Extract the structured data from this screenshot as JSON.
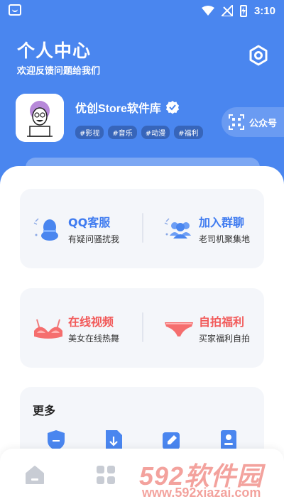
{
  "status_bar": {
    "time": "3:10"
  },
  "header": {
    "title": "个人中心",
    "subtitle": "欢迎反馈问题给我们",
    "settings_icon": "settings-hexagon-icon"
  },
  "profile": {
    "name": "优创Store软件库",
    "verified_icon": "verified-badge-icon",
    "tags": [
      "#影视",
      "#音乐",
      "#动漫",
      "#福利"
    ],
    "official_account_label": "公众号"
  },
  "contact_card": {
    "items": [
      {
        "title": "QQ客服",
        "subtitle": "有疑问骚扰我",
        "icon": "qq-penguin-icon"
      },
      {
        "title": "加入群聊",
        "subtitle": "老司机聚集地",
        "icon": "group-users-icon"
      }
    ]
  },
  "fun_card": {
    "items": [
      {
        "title": "在线视频",
        "subtitle": "美女在线热舞",
        "icon": "bra-icon"
      },
      {
        "title": "自拍福利",
        "subtitle": "买家福利自拍",
        "icon": "underwear-icon"
      }
    ]
  },
  "more_card": {
    "title": "更多",
    "icons": [
      "shield-icon",
      "download-file-icon",
      "edit-icon",
      "contact-book-icon"
    ]
  },
  "bottom_nav": {
    "items": [
      "home-icon",
      "grid-apps-icon"
    ]
  },
  "watermark": {
    "line1": "592软件园",
    "line2": "www.592xiazai.com"
  },
  "colors": {
    "accent_blue": "#4a86ef",
    "link_blue": "#3f7bf0",
    "accent_red": "#f25a5a"
  }
}
